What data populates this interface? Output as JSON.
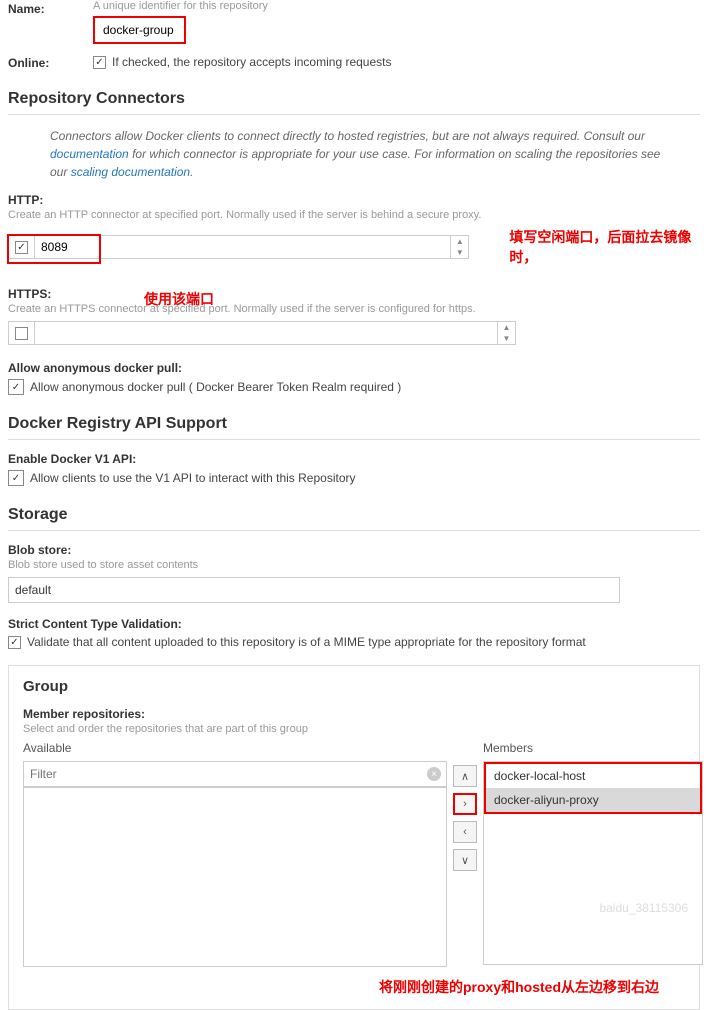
{
  "name": {
    "label": "Name:",
    "hint": "A unique identifier for this repository",
    "value": "docker-group"
  },
  "online": {
    "label": "Online:",
    "checked": true,
    "desc": "If checked, the repository accepts incoming requests"
  },
  "connectors": {
    "title": "Repository Connectors",
    "help_1": "Connectors allow Docker clients to connect directly to hosted registries, but are not always required. Consult our ",
    "help_link1": "documentation",
    "help_2": " for which connector is appropriate for your use case. For information on scaling the repositories see our ",
    "help_link2": "scaling documentation",
    "help_3": ".",
    "http": {
      "label": "HTTP:",
      "hint": "Create an HTTP connector at specified port. Normally used if the server is behind a secure proxy.",
      "checked": true,
      "port": "8089",
      "note1": "填写空闲端口，后面拉去镜像时，",
      "note2": "使用该端口"
    },
    "https": {
      "label": "HTTPS:",
      "hint": "Create an HTTPS connector at specified port. Normally used if the server is configured for https.",
      "checked": false,
      "port": ""
    },
    "anon": {
      "label": "Allow anonymous docker pull:",
      "checked": true,
      "desc": "Allow anonymous docker pull ( Docker Bearer Token Realm required )"
    }
  },
  "api": {
    "title": "Docker Registry API Support",
    "v1": {
      "label": "Enable Docker V1 API:",
      "checked": true,
      "desc": "Allow clients to use the V1 API to interact with this Repository"
    }
  },
  "storage": {
    "title": "Storage",
    "blob": {
      "label": "Blob store:",
      "hint": "Blob store used to store asset contents",
      "value": "default"
    },
    "strict": {
      "label": "Strict Content Type Validation:",
      "checked": true,
      "desc": "Validate that all content uploaded to this repository is of a MIME type appropriate for the repository format"
    }
  },
  "group": {
    "title": "Group",
    "member_label": "Member repositories:",
    "member_hint": "Select and order the repositories that are part of this group",
    "available_label": "Available",
    "members_label": "Members",
    "filter_placeholder": "Filter",
    "members": [
      "docker-local-host",
      "docker-aliyun-proxy"
    ],
    "note": "将刚刚创建的proxy和hosted从左边移到右边"
  },
  "watermark": "baidu_38115306"
}
